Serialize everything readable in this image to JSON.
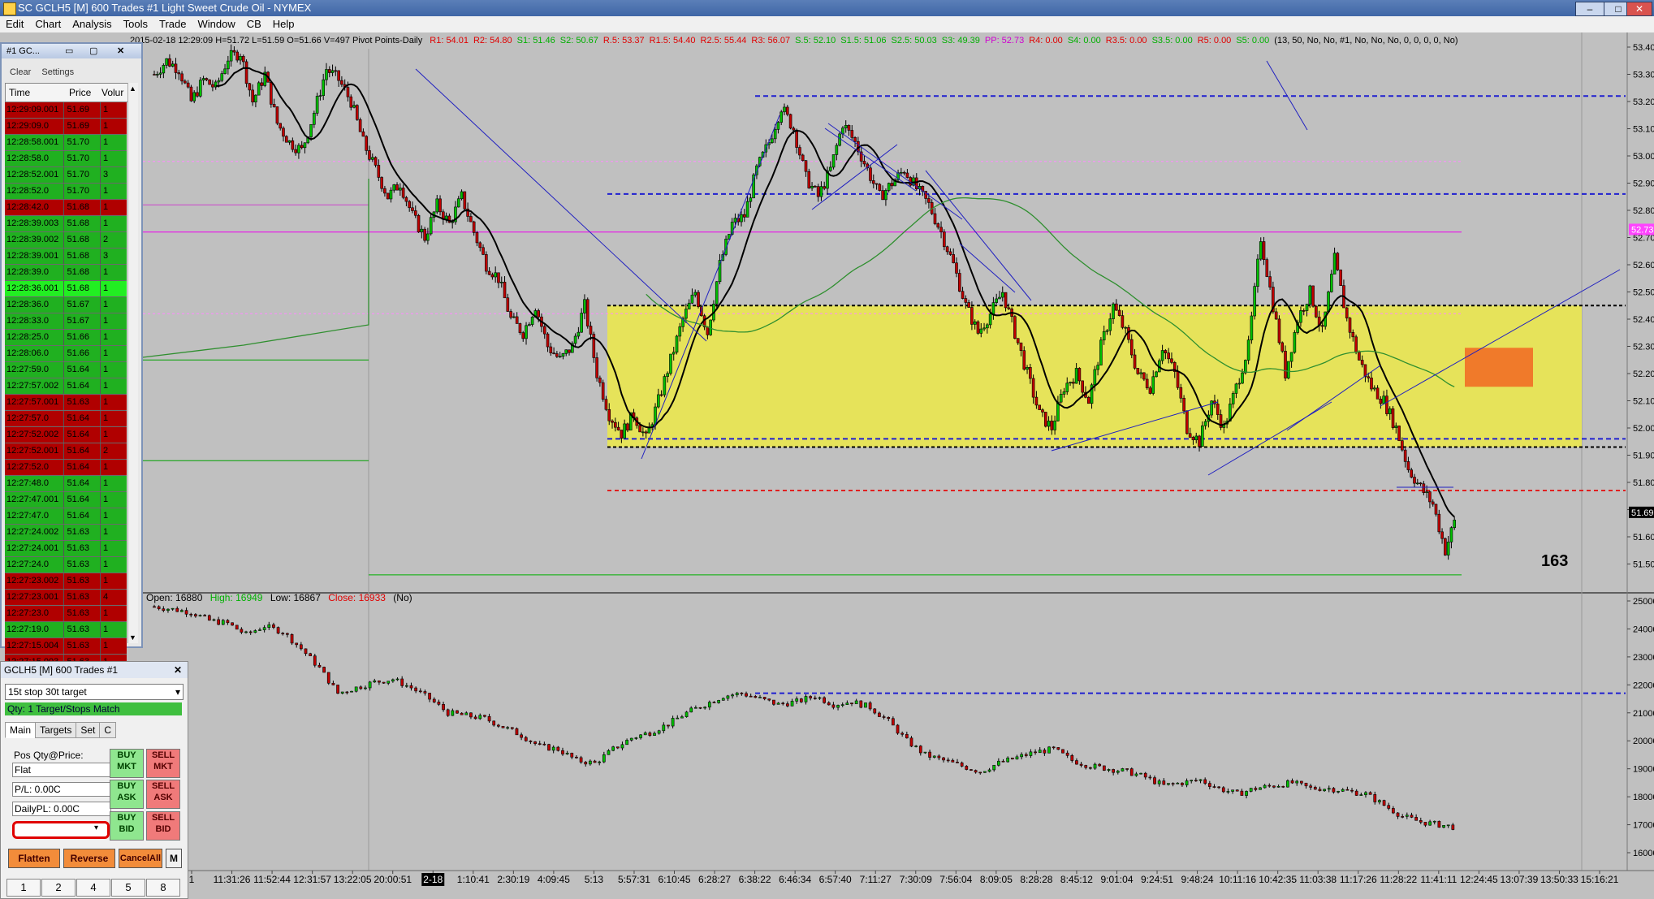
{
  "window": {
    "title": "SC GCLH5 [M]  600 Trades  #1  Light Sweet Crude Oil - NYMEX"
  },
  "menu": [
    "Edit",
    "Chart",
    "Analysis",
    "Tools",
    "Trade",
    "Window",
    "CB",
    "Help"
  ],
  "colors": {
    "up": "#00c000",
    "down": "#c00000",
    "zone": "#e6e35a",
    "blueDash": "#1f1fd0",
    "redDash": "#e02020",
    "orange": "#f07a2a"
  },
  "upper_info": {
    "date_ohlc": "2015-02-18 12:29:09 H=51.72 L=51.59 O=51.66 V=497 Pivot Points-Daily",
    "pivots": [
      {
        "t": "R1: 54.01",
        "c": "#e00000"
      },
      {
        "t": "R2: 54.80",
        "c": "#e00000"
      },
      {
        "t": "S1: 51.46",
        "c": "#00b000"
      },
      {
        "t": "S2: 50.67",
        "c": "#00b000"
      },
      {
        "t": "R.5: 53.37",
        "c": "#e00000"
      },
      {
        "t": "R1.5: 54.40",
        "c": "#e00000"
      },
      {
        "t": "R2.5: 55.44",
        "c": "#e00000"
      },
      {
        "t": "R3: 56.07",
        "c": "#e00000"
      },
      {
        "t": "S.5: 52.10",
        "c": "#00b000"
      },
      {
        "t": "S1.5: 51.06",
        "c": "#00b000"
      },
      {
        "t": "S2.5: 50.03",
        "c": "#00b000"
      },
      {
        "t": "S3: 49.39",
        "c": "#00b000"
      },
      {
        "t": "PP: 52.73",
        "c": "#d000d0"
      },
      {
        "t": "R4: 0.00",
        "c": "#e00000"
      },
      {
        "t": "S4: 0.00",
        "c": "#00b000"
      },
      {
        "t": "R3.5: 0.00",
        "c": "#e00000"
      },
      {
        "t": "S3.5: 0.00",
        "c": "#00b000"
      },
      {
        "t": "R5: 0.00",
        "c": "#e00000"
      },
      {
        "t": "S5: 0.00",
        "c": "#00b000"
      },
      {
        "t": "(13, 50, No, No, #1, No, No, No, 0, 0, 0, 0, No)",
        "c": "#000000"
      }
    ]
  },
  "lower_info": {
    "open": "Open: 16880",
    "high": "High: 16949",
    "low": "Low: 16867",
    "close": "Close: 16933",
    "flag": "(No)"
  },
  "trade_count": "163",
  "chart_data": [
    {
      "type": "candlestick",
      "title": "GCLH5 [M] 600 Trades #1",
      "ylim": [
        51.4,
        53.4
      ],
      "y_ticks": [
        "53.40",
        "53.30",
        "53.20",
        "53.10",
        "53.00",
        "52.90",
        "52.80",
        "52.70",
        "52.60",
        "52.50",
        "52.40",
        "52.30",
        "52.20",
        "52.10",
        "52.00",
        "51.90",
        "51.80",
        "51.70",
        "51.60",
        "51.50"
      ],
      "price_markers": [
        {
          "label": "52.73",
          "value": 52.73,
          "color": "#ff44ff"
        },
        {
          "label": "51.69",
          "value": 51.69,
          "color": "#000000"
        }
      ],
      "close_path": [
        53.3,
        53.35,
        53.32,
        53.2,
        53.28,
        53.25,
        53.36,
        53.38,
        53.2,
        53.3,
        53.12,
        53.05,
        53.02,
        53.16,
        53.32,
        53.28,
        53.2,
        53.05,
        52.95,
        52.85,
        52.9,
        52.78,
        52.7,
        52.82,
        52.75,
        52.85,
        52.72,
        52.6,
        52.55,
        52.4,
        52.35,
        52.45,
        52.3,
        52.25,
        52.3,
        52.45,
        52.2,
        52.05,
        51.98,
        52.05,
        51.96,
        52.1,
        52.25,
        52.4,
        52.5,
        52.35,
        52.6,
        52.75,
        52.78,
        52.95,
        53.05,
        53.18,
        53.1,
        52.92,
        52.85,
        52.95,
        53.12,
        53.05,
        52.95,
        52.85,
        52.9,
        52.95,
        52.88,
        52.82,
        52.72,
        52.6,
        52.45,
        52.35,
        52.42,
        52.5,
        52.35,
        52.2,
        52.05,
        52.0,
        52.15,
        52.2,
        52.1,
        52.3,
        52.45,
        52.35,
        52.2,
        52.15,
        52.3,
        52.2,
        52.0,
        51.95,
        52.1,
        52.0,
        52.15,
        52.3,
        52.7,
        52.45,
        52.2,
        52.4,
        52.5,
        52.35,
        52.62,
        52.4,
        52.25,
        52.15,
        52.1,
        52.0,
        51.85,
        51.78,
        51.72,
        51.55,
        51.69
      ],
      "zone": {
        "from": 51.93,
        "to": 52.45
      },
      "horizontal_levels": [
        {
          "value": 53.22,
          "style": "blue-dash"
        },
        {
          "value": 52.86,
          "style": "blue-dash"
        },
        {
          "value": 52.45,
          "style": "black-dash"
        },
        {
          "value": 51.93,
          "style": "black-dash"
        },
        {
          "value": 51.96,
          "style": "blue-dash"
        },
        {
          "value": 51.77,
          "style": "red-dash"
        }
      ]
    },
    {
      "type": "candlestick",
      "title": "lower panel",
      "ylim": [
        16000,
        25000
      ],
      "y_ticks": [
        "25000",
        "24000",
        "23000",
        "22000",
        "21000",
        "20000",
        "19000",
        "18000",
        "17000",
        "16000"
      ],
      "close_path": [
        24800,
        24700,
        24600,
        24300,
        24200,
        23800,
        24100,
        23900,
        23300,
        22600,
        21700,
        21900,
        22100,
        22200,
        21900,
        21500,
        21000,
        20900,
        20800,
        20500,
        20200,
        19800,
        19700,
        19300,
        19200,
        19700,
        20100,
        20300,
        20600,
        21000,
        21300,
        21600,
        21700,
        21500,
        21300,
        21400,
        21600,
        21300,
        21400,
        21200,
        20700,
        20000,
        19500,
        19300,
        19100,
        18900,
        19200,
        19400,
        19600,
        19700,
        19300,
        19100,
        19000,
        18900,
        18700,
        18400,
        18500,
        18600,
        18300,
        18100,
        18300,
        18400,
        18500,
        18300,
        18300,
        18200,
        18100,
        17700,
        17300,
        17100,
        17000,
        16900
      ],
      "horizontal_levels": [
        {
          "value": 21700,
          "style": "blue-dash"
        }
      ]
    }
  ],
  "x_axis_labels": [
    "1",
    "11:31:26",
    "11:52:44",
    "12:31:57",
    "13:22:05",
    "20:00:51",
    "2-18",
    "1:10:41",
    "2:30:19",
    "4:09:45",
    "5:13",
    "5:57:31",
    "6:10:45",
    "6:28:27",
    "6:38:22",
    "6:46:34",
    "6:57:40",
    "7:11:27",
    "7:30:09",
    "7:56:04",
    "8:09:05",
    "8:28:28",
    "8:45:12",
    "9:01:04",
    "9:24:51",
    "9:48:24",
    "10:11:16",
    "10:42:35",
    "11:03:38",
    "11:17:26",
    "11:28:22",
    "11:41:11",
    "12:24:45",
    "13:07:39",
    "13:50:33",
    "15:16:21"
  ],
  "time_sales": {
    "title": "#1 GC...",
    "toolbar": [
      "Clear",
      "Settings"
    ],
    "columns": [
      "Time",
      "Price",
      "Volur"
    ],
    "rows": [
      {
        "t": "12:29:09.001",
        "p": "51.69",
        "v": "1",
        "s": "down"
      },
      {
        "t": "12:29:09.0",
        "p": "51.69",
        "v": "1",
        "s": "down"
      },
      {
        "t": "12:28:58.001",
        "p": "51.70",
        "v": "1",
        "s": "up"
      },
      {
        "t": "12:28:58.0",
        "p": "51.70",
        "v": "1",
        "s": "up"
      },
      {
        "t": "12:28:52.001",
        "p": "51.70",
        "v": "3",
        "s": "up"
      },
      {
        "t": "12:28:52.0",
        "p": "51.70",
        "v": "1",
        "s": "up"
      },
      {
        "t": "12:28:42.0",
        "p": "51.68",
        "v": "1",
        "s": "down"
      },
      {
        "t": "12:28:39.003",
        "p": "51.68",
        "v": "1",
        "s": "up"
      },
      {
        "t": "12:28:39.002",
        "p": "51.68",
        "v": "2",
        "s": "up"
      },
      {
        "t": "12:28:39.001",
        "p": "51.68",
        "v": "3",
        "s": "up"
      },
      {
        "t": "12:28:39.0",
        "p": "51.68",
        "v": "1",
        "s": "up"
      },
      {
        "t": "12:28:36.001",
        "p": "51.68",
        "v": "1",
        "s": "bright"
      },
      {
        "t": "12:28:36.0",
        "p": "51.67",
        "v": "1",
        "s": "up"
      },
      {
        "t": "12:28:33.0",
        "p": "51.67",
        "v": "1",
        "s": "up"
      },
      {
        "t": "12:28:25.0",
        "p": "51.66",
        "v": "1",
        "s": "up"
      },
      {
        "t": "12:28:06.0",
        "p": "51.66",
        "v": "1",
        "s": "up"
      },
      {
        "t": "12:27:59.0",
        "p": "51.64",
        "v": "1",
        "s": "up"
      },
      {
        "t": "12:27:57.002",
        "p": "51.64",
        "v": "1",
        "s": "up"
      },
      {
        "t": "12:27:57.001",
        "p": "51.63",
        "v": "1",
        "s": "down"
      },
      {
        "t": "12:27:57.0",
        "p": "51.64",
        "v": "1",
        "s": "down"
      },
      {
        "t": "12:27:52.002",
        "p": "51.64",
        "v": "1",
        "s": "down"
      },
      {
        "t": "12:27:52.001",
        "p": "51.64",
        "v": "2",
        "s": "down"
      },
      {
        "t": "12:27:52.0",
        "p": "51.64",
        "v": "1",
        "s": "down"
      },
      {
        "t": "12:27:48.0",
        "p": "51.64",
        "v": "1",
        "s": "up"
      },
      {
        "t": "12:27:47.001",
        "p": "51.64",
        "v": "1",
        "s": "up"
      },
      {
        "t": "12:27:47.0",
        "p": "51.64",
        "v": "1",
        "s": "up"
      },
      {
        "t": "12:27:24.002",
        "p": "51.63",
        "v": "1",
        "s": "up"
      },
      {
        "t": "12:27:24.001",
        "p": "51.63",
        "v": "1",
        "s": "up"
      },
      {
        "t": "12:27:24.0",
        "p": "51.63",
        "v": "1",
        "s": "up"
      },
      {
        "t": "12:27:23.002",
        "p": "51.63",
        "v": "1",
        "s": "down"
      },
      {
        "t": "12:27:23.001",
        "p": "51.63",
        "v": "4",
        "s": "down"
      },
      {
        "t": "12:27:23.0",
        "p": "51.63",
        "v": "1",
        "s": "down"
      },
      {
        "t": "12:27:19.0",
        "p": "51.63",
        "v": "1",
        "s": "up"
      },
      {
        "t": "12:27:15.004",
        "p": "51.63",
        "v": "1",
        "s": "down"
      },
      {
        "t": "12:27:15.003",
        "p": "51.63",
        "v": "1",
        "s": "down"
      }
    ]
  },
  "order_panel": {
    "title": "GCLH5 [M]  600 Trades  #1",
    "strategy": "15t stop 30t target",
    "qty_status": "Qty: 1 Target/Stops Match",
    "tabs": [
      "Main",
      "Targets",
      "Set",
      "C"
    ],
    "pos_label": "Pos Qty@Price:",
    "pos_value": "Flat",
    "pl_value": "P/L: 0.00C",
    "daily_pl_value": "DailyPL: 0.00C",
    "buy_mkt": "BUY\nMKT",
    "sell_mkt": "SELL\nMKT",
    "buy_ask": "BUY\nASK",
    "sell_ask": "SELL\nASK",
    "buy_bid": "BUY\nBID",
    "sell_bid": "SELL\nBID",
    "flatten": "Flatten",
    "reverse": "Reverse",
    "cancel_all": "CancelAll",
    "m_btn": "M",
    "quick_qty": [
      "1",
      "2",
      "4",
      "5",
      "8"
    ]
  }
}
